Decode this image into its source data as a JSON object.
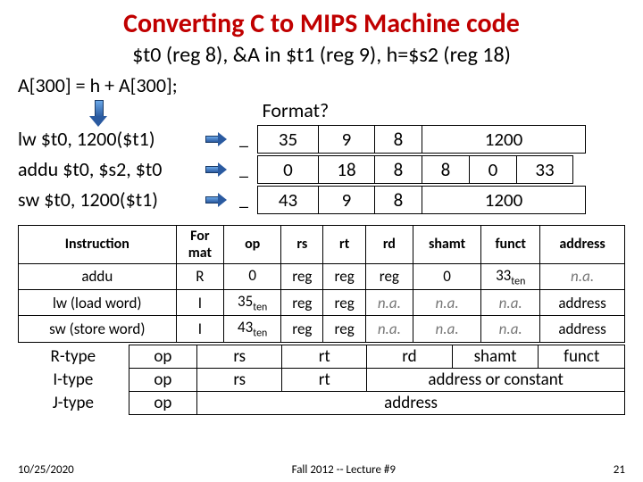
{
  "title": "Converting C to MIPS Machine code",
  "subtitle": "$t0 (reg 8), &A in $t1 (reg 9), h=$s2 (reg 18)",
  "c_stmt": "A[300] = h + A[300];",
  "format_label": "Format?",
  "instrs": {
    "lw": "lw $t0, 1200($t1)",
    "addu": "addu $t0, $s2, $t0",
    "sw": "sw $t0, 1200($t1)"
  },
  "blank": "_",
  "enc": {
    "lw": {
      "op": "35",
      "rs": "9",
      "rt": "8",
      "imm": "1200"
    },
    "addu": {
      "op": "0",
      "rs": "18",
      "rt": "8",
      "rd": "8",
      "shamt": "0",
      "funct": "33"
    },
    "sw": {
      "op": "43",
      "rs": "9",
      "rt": "8",
      "imm": "1200"
    }
  },
  "ref": {
    "headers": {
      "instr": "Instruction",
      "format": "For\nmat",
      "op": "op",
      "rs": "rs",
      "rt": "rt",
      "rd": "rd",
      "shamt": "shamt",
      "funct": "funct",
      "address": "address"
    },
    "rows": [
      {
        "instr": "addu",
        "format": "R",
        "op": "0",
        "op_sub": "",
        "rs": "reg",
        "rt": "reg",
        "rd": "reg",
        "shamt": "0",
        "funct": "33",
        "funct_sub": "ten",
        "address": "n.a."
      },
      {
        "instr": "lw (load word)",
        "format": "I",
        "op": "35",
        "op_sub": "ten",
        "rs": "reg",
        "rt": "reg",
        "rd": "n.a.",
        "shamt": "n.a.",
        "funct": "n.a.",
        "funct_sub": "",
        "address": "address"
      },
      {
        "instr": "sw (store word)",
        "format": "I",
        "op": "43",
        "op_sub": "ten",
        "rs": "reg",
        "rt": "reg",
        "rd": "n.a.",
        "shamt": "n.a.",
        "funct": "n.a.",
        "funct_sub": "",
        "address": "address"
      }
    ]
  },
  "types": {
    "r": {
      "label": "R-type",
      "f": [
        "op",
        "rs",
        "rt",
        "rd",
        "shamt",
        "funct"
      ]
    },
    "i": {
      "label": "I-type",
      "f": [
        "op",
        "rs",
        "rt",
        "address or constant"
      ]
    },
    "j": {
      "label": "J-type",
      "f": [
        "op",
        "address"
      ]
    }
  },
  "footer": {
    "date": "10/25/2020",
    "mid": "Fall 2012 -- Lecture #9",
    "page": "21"
  }
}
